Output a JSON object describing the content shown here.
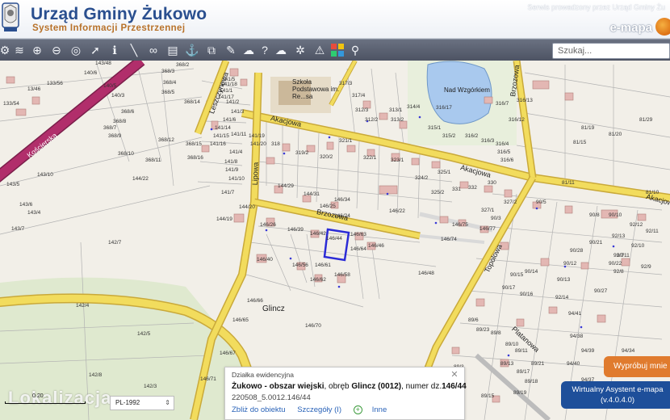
{
  "header": {
    "title": "Urząd Gminy Żukowo",
    "subtitle": "System Informacji Przestrzennej",
    "service_note": "Serwis prowadzony przez Urząd Gminy Żu",
    "brand": "e-mapa"
  },
  "toolbar": {
    "tools": [
      "layers-icon",
      "stack-icon",
      "zoom-in-icon",
      "zoom-out-icon",
      "full-extent-icon",
      "pointer-icon",
      "info-icon",
      "measure-icon",
      "link-icon",
      "print-icon",
      "anchor-icon",
      "export-icon",
      "comment-icon",
      "help-icon",
      "cloud-icon",
      "settings-icon",
      "warning-icon",
      "grid-icon",
      "pin-search-icon"
    ],
    "search_placeholder": "Szukaj..."
  },
  "map": {
    "streets": [
      {
        "text": "Kościerska"
      },
      {
        "text": "Akacjowa"
      },
      {
        "text": "Akacjowa"
      },
      {
        "text": "Akacjowa"
      },
      {
        "text": "Lipowa"
      },
      {
        "text": "Brzozowa"
      },
      {
        "text": "Leszczynowa"
      },
      {
        "text": "Topolowa"
      },
      {
        "text": "Brzozowa"
      },
      {
        "text": "Platanowa"
      }
    ],
    "places": [
      "Szkoła Podstawowa im. Re...sa",
      "Nad Wzgórkiem",
      "Glincz"
    ],
    "parcel_labels": [
      "133/56",
      "133/54",
      "13/46",
      "140/3",
      "143/10",
      "143/5",
      "143/4",
      "143/7",
      "143/6",
      "368/2",
      "368/3",
      "368/4",
      "368/5",
      "368/14",
      "368/6",
      "368/7",
      "368/8",
      "368/9",
      "368/10",
      "368/11",
      "368/12",
      "368/16",
      "368/15",
      "143/48",
      "140/6",
      "140/5",
      "144/22",
      "142/7",
      "142/4",
      "142/5",
      "142/8",
      "142/3",
      "141/1",
      "141/2",
      "141/3",
      "141/4",
      "141/5",
      "141/6",
      "141/7",
      "141/8",
      "141/9",
      "141/10",
      "141/11",
      "141/14",
      "141/15",
      "141/16",
      "141/17",
      "141/18",
      "141/19",
      "141/20",
      "144/19",
      "144/20",
      "144/29",
      "144/31",
      "146/26",
      "146/22",
      "146/24",
      "146/25",
      "146/34",
      "146/39",
      "146/42",
      "146/44",
      "146/63",
      "146/64",
      "146/46",
      "146/40",
      "146/56",
      "146/61",
      "146/58",
      "146/62",
      "146/48",
      "146/66",
      "146/65",
      "146/67",
      "146/70",
      "146/71",
      "146/74",
      "146/75",
      "146/77",
      "318",
      "319/2",
      "320/2",
      "321/1",
      "322/1",
      "323/1",
      "324/2",
      "325/1",
      "325/2",
      "327/1",
      "327/2",
      "332",
      "331",
      "330",
      "317/3",
      "317/4",
      "312/3",
      "312/2",
      "313/1",
      "313/2",
      "314/4",
      "315/1",
      "315/2",
      "316/2",
      "316/3",
      "316/4",
      "316/5",
      "316/6",
      "316/7",
      "316/12",
      "316/13",
      "316/17",
      "81/20",
      "81/19",
      "81/11",
      "81/15",
      "81/29",
      "81/10",
      "90/3",
      "90/5",
      "90/8",
      "90/10",
      "90/11",
      "90/12",
      "90/13",
      "90/14",
      "90/15",
      "90/16",
      "90/17",
      "90/21",
      "90/22",
      "90/27",
      "90/28",
      "89/6",
      "89/8",
      "89/10",
      "89/11",
      "89/13",
      "89/15",
      "89/17",
      "89/18",
      "89/19",
      "89/21",
      "89/23",
      "89/3",
      "94/34",
      "94/35",
      "94/37",
      "94/38",
      "94/39",
      "94/40",
      "94/41",
      "92/7",
      "92/8",
      "92/9",
      "92/10",
      "92/11",
      "92/12",
      "92/13",
      "92/14"
    ],
    "selected_parcel": "146/44"
  },
  "popup": {
    "heading": "Działka ewidencyjna",
    "location_bold": "Żukowo - obszar wiejski",
    "obreb_prefix": ", obręb",
    "obreb_bold": "Glincz (0012)",
    "numer_prefix": ", numer dz.",
    "numer_bold": "146/44",
    "identifier": "220508_5.0012.146/44",
    "link_zoom": "Zbliż do obiektu",
    "link_details": "Szczegóły (I)",
    "link_other": "Inne"
  },
  "bottom": {
    "crs": "PL-1992",
    "scale_text": "0 20",
    "watermark": "Lokalizacja",
    "try_button": "Wypróbuj mnie",
    "assistant_line1": "Wirtualny Asystent e-mapa",
    "assistant_line2": "(v.4.0.4.0)"
  },
  "colors": {
    "road_fill": "#f2dc5d",
    "road_edge": "#c9a93a",
    "main_road": "#b12e6b",
    "parcel_line": "#a8a8a8",
    "building": "#e3b7b3",
    "selected": "#2b2bd6",
    "water": "#a9c9ee",
    "green": "#d9e8c4"
  }
}
